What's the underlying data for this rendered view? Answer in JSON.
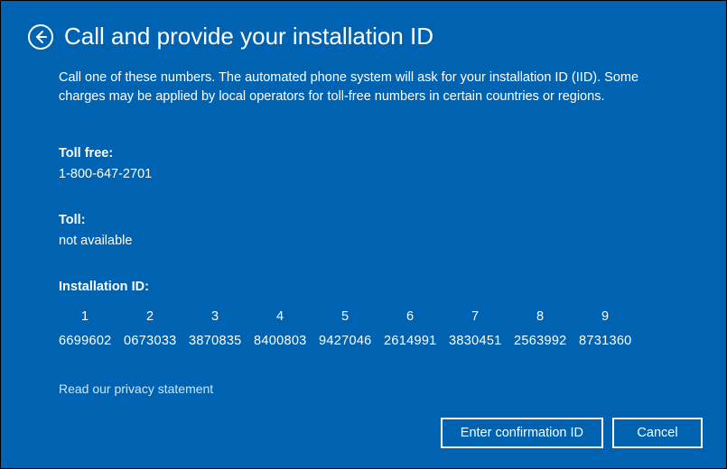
{
  "header": {
    "title": "Call and provide your installation ID"
  },
  "description": "Call one of these numbers. The automated phone system will ask for your installation ID (IID). Some charges may be applied by local operators for toll-free numbers in certain countries or regions.",
  "toll_free": {
    "label": "Toll free:",
    "value": "1-800-647-2701"
  },
  "toll": {
    "label": "Toll:",
    "value": "not available"
  },
  "iid": {
    "label": "Installation ID:",
    "columns": [
      {
        "idx": "1",
        "val": "6699602"
      },
      {
        "idx": "2",
        "val": "0673033"
      },
      {
        "idx": "3",
        "val": "3870835"
      },
      {
        "idx": "4",
        "val": "8400803"
      },
      {
        "idx": "5",
        "val": "9427046"
      },
      {
        "idx": "6",
        "val": "2614991"
      },
      {
        "idx": "7",
        "val": "3830451"
      },
      {
        "idx": "8",
        "val": "2563992"
      },
      {
        "idx": "9",
        "val": "8731360"
      }
    ]
  },
  "privacy": "Read our privacy statement",
  "buttons": {
    "enter": "Enter confirmation ID",
    "cancel": "Cancel"
  }
}
